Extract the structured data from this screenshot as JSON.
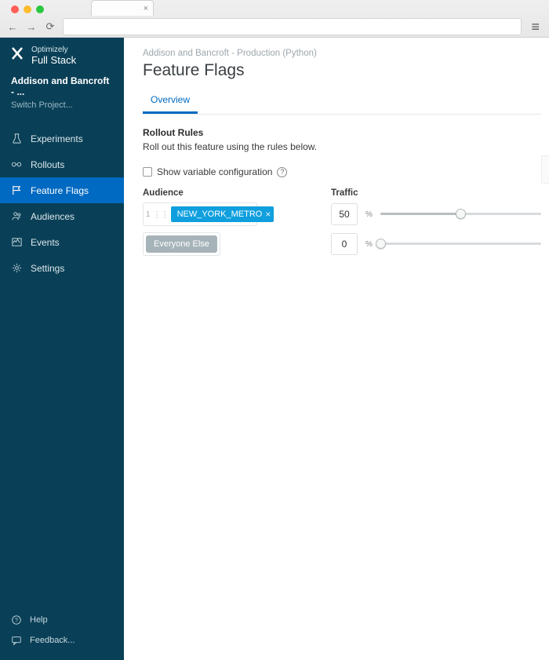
{
  "brand": {
    "line1": "Optimizely",
    "line2": "Full Stack"
  },
  "project": {
    "name": "Addison and Bancroft - ...",
    "switch": "Switch Project..."
  },
  "nav": [
    {
      "label": "Experiments"
    },
    {
      "label": "Rollouts"
    },
    {
      "label": "Feature Flags"
    },
    {
      "label": "Audiences"
    },
    {
      "label": "Events"
    },
    {
      "label": "Settings"
    }
  ],
  "footer": [
    {
      "label": "Help"
    },
    {
      "label": "Feedback..."
    }
  ],
  "breadcrumb": "Addison and Bancroft - Production (Python)",
  "page_title": "Feature Flags",
  "tab_overview": "Overview",
  "rollout": {
    "heading": "Rollout Rules",
    "desc": "Roll out this feature using the rules below.",
    "config_label": "Show variable configuration"
  },
  "columns": {
    "audience": "Audience",
    "traffic": "Traffic"
  },
  "rules": [
    {
      "index": "1",
      "chip": "NEW_YORK_METRO",
      "traffic": "50",
      "pct": 50,
      "kind": "audience"
    },
    {
      "chip": "Everyone Else",
      "traffic": "0",
      "pct": 0,
      "kind": "else"
    }
  ],
  "percent": "%"
}
